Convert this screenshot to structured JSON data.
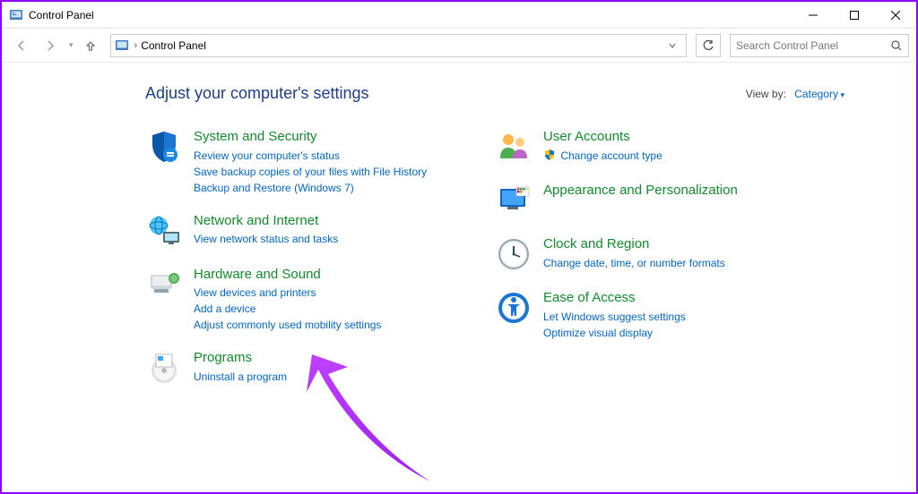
{
  "window": {
    "title": "Control Panel"
  },
  "navigation": {
    "breadcrumb": "Control Panel",
    "chevron": "›",
    "search_placeholder": "Search Control Panel"
  },
  "header": {
    "title": "Adjust your computer's settings",
    "viewby_label": "View by:",
    "viewby_value": "Category"
  },
  "left_column": [
    {
      "title": "System and Security",
      "links": [
        "Review your computer's status",
        "Save backup copies of your files with File History",
        "Backup and Restore (Windows 7)"
      ]
    },
    {
      "title": "Network and Internet",
      "links": [
        "View network status and tasks"
      ]
    },
    {
      "title": "Hardware and Sound",
      "links": [
        "View devices and printers",
        "Add a device",
        "Adjust commonly used mobility settings"
      ]
    },
    {
      "title": "Programs",
      "links": [
        "Uninstall a program"
      ]
    }
  ],
  "right_column": [
    {
      "title": "User Accounts",
      "links_with_icon": [
        {
          "icon": "shield",
          "text": "Change account type"
        }
      ]
    },
    {
      "title": "Appearance and Personalization",
      "links": []
    },
    {
      "title": "Clock and Region",
      "links": [
        "Change date, time, or number formats"
      ]
    },
    {
      "title": "Ease of Access",
      "links": [
        "Let Windows suggest settings",
        "Optimize visual display"
      ]
    }
  ]
}
